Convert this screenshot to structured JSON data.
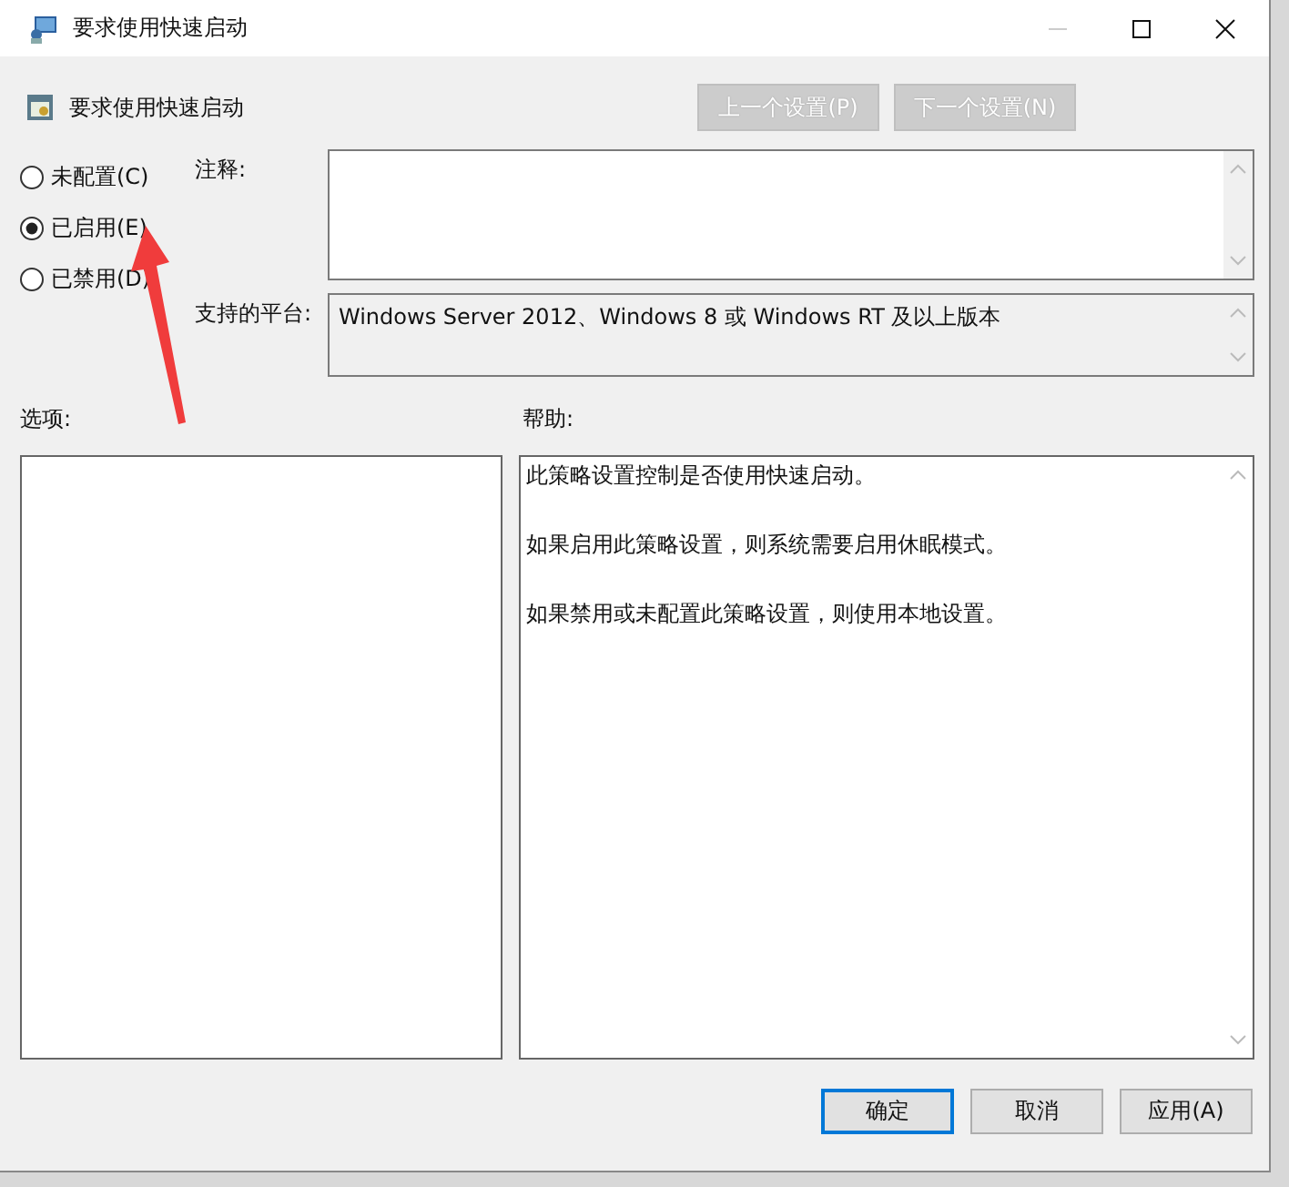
{
  "window": {
    "title": "要求使用快速启动"
  },
  "header": {
    "title": "要求使用快速启动"
  },
  "nav_buttons": [
    {
      "label": "上一个设置(P)",
      "disabled": true
    },
    {
      "label": "下一个设置(N)",
      "disabled": true
    }
  ],
  "radios": [
    {
      "label": "未配置(C)",
      "selected": false
    },
    {
      "label": "已启用(E)",
      "selected": true
    },
    {
      "label": "已禁用(D)",
      "selected": false
    }
  ],
  "comment": {
    "label": "注释:"
  },
  "platform": {
    "label": "支持的平台:",
    "value": "Windows Server 2012、Windows 8 或 Windows RT 及以上版本"
  },
  "options": {
    "label": "选项:"
  },
  "help": {
    "label": "帮助:",
    "paragraphs": [
      "此策略设置控制是否使用快速启动。",
      "如果启用此策略设置，则系统需要启用休眠模式。",
      "如果禁用或未配置此策略设置，则使用本地设置。"
    ]
  },
  "buttons": [
    {
      "label": "确定",
      "default": true
    },
    {
      "label": "取消",
      "default": false
    },
    {
      "label": "应用(A)",
      "default": false
    }
  ]
}
